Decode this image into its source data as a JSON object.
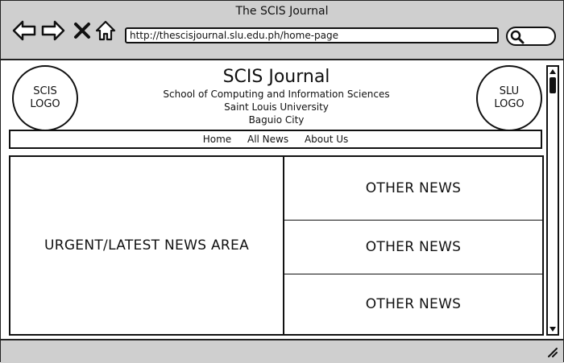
{
  "window": {
    "title": "The SCIS Journal"
  },
  "browser": {
    "url": "http://thescisjournal.slu.edu.ph/home-page"
  },
  "header": {
    "left_logo": [
      "SCIS",
      "LOGO"
    ],
    "right_logo": [
      "SLU",
      "LOGO"
    ],
    "site_title": "SCIS Journal",
    "line1": "School of Computing and Information Sciences",
    "line2": "Saint Louis University",
    "line3": "Baguio City"
  },
  "nav": {
    "items": [
      "Home",
      "All News",
      "About Us"
    ]
  },
  "main": {
    "urgent_label": "URGENT/LATEST NEWS AREA",
    "other": [
      "OTHER NEWS",
      "OTHER NEWS",
      "OTHER NEWS"
    ]
  },
  "icons": [
    "back-arrow-icon",
    "forward-arrow-icon",
    "close-icon",
    "home-icon",
    "search-icon",
    "resize-grip-icon"
  ],
  "colors": {
    "chrome": "#cfcfcf",
    "border": "#111111",
    "background": "#ffffff"
  }
}
